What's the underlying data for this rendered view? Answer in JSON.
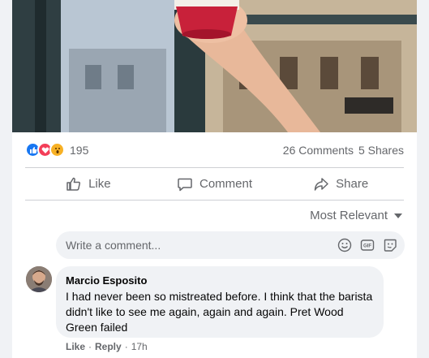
{
  "post": {
    "reactions": {
      "count": "195",
      "types": [
        "like-icon",
        "love-icon",
        "wow-icon"
      ]
    },
    "comments_count": "26 Comments",
    "shares_count": "5 Shares"
  },
  "actions": {
    "like": "Like",
    "comment": "Comment",
    "share": "Share"
  },
  "sort": {
    "label": "Most Relevant"
  },
  "composer": {
    "placeholder": "Write a comment..."
  },
  "comment": {
    "author": "Marcio Esposito",
    "text": "I had never been so mistreated before. I think that the barista didn't like to see me again, again and again. Pret Wood Green failed",
    "like_label": "Like",
    "separator": "·",
    "reply_label": "Reply",
    "time": "17h"
  },
  "colors": {
    "like_blue": "#1877f2",
    "love_red": "#f33e58",
    "wow_yellow": "#f7b125",
    "secondary_text": "#65676b",
    "bubble_bg": "#f0f2f5"
  }
}
